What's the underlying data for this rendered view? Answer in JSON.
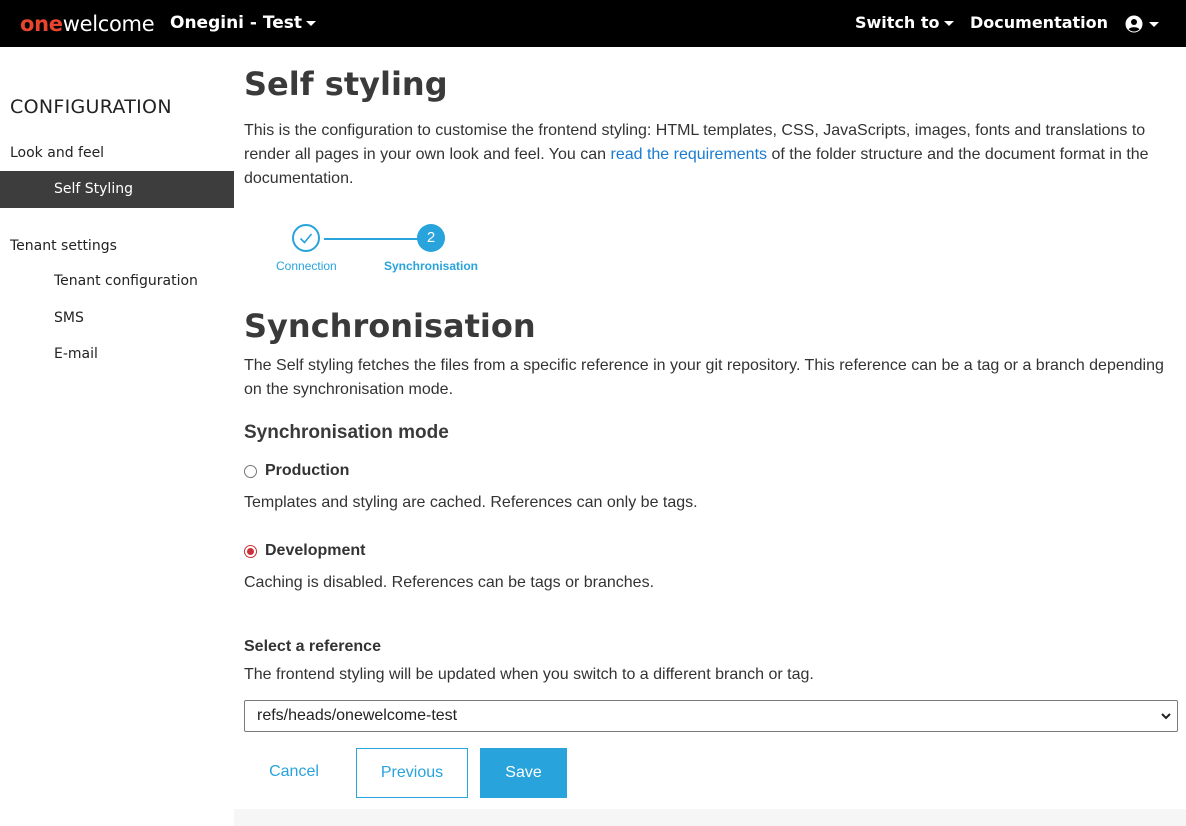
{
  "navbar": {
    "logo_one": "one",
    "logo_welcome": "welcome",
    "tenant": "Onegini - Test",
    "switch_to": "Switch to",
    "documentation": "Documentation",
    "user_icon": "user-circle-icon"
  },
  "sidebar": {
    "heading": "CONFIGURATION",
    "group_look": "Look and feel",
    "self_styling": "Self Styling",
    "group_tenant": "Tenant settings",
    "tenant_configuration": "Tenant configuration",
    "sms": "SMS",
    "email": "E-mail"
  },
  "main": {
    "title": "Self styling",
    "intro_before": "This is the configuration to customise the frontend styling: HTML templates, CSS, JavaScripts, images, fonts and translations to render all pages in your own look and feel. You can ",
    "intro_link": "read the requirements",
    "intro_after": " of the folder structure and the document format in the documentation.",
    "stepper": {
      "step1_label": "Connection",
      "step2_number": "2",
      "step2_label": "Synchronisation"
    },
    "section_title": "Synchronisation",
    "section_desc": "The Self styling fetches the files from a specific reference in your git repository. This reference can be a tag or a branch depending on the synchronisation mode.",
    "mode_title": "Synchronisation mode",
    "production_label": "Production",
    "production_desc": "Templates and styling are cached. References can only be tags.",
    "development_label": "Development",
    "development_desc": "Caching is disabled. References can be tags or branches.",
    "reference_label": "Select a reference",
    "reference_help": "The frontend styling will be updated when you switch to a different branch or tag.",
    "reference_value": "refs/heads/onewelcome-test",
    "cancel": "Cancel",
    "previous": "Previous",
    "save": "Save"
  },
  "colors": {
    "accent": "#28a3dc",
    "logo_red": "#e8442e",
    "radio_selected": "#c9303a",
    "sidebar_active": "#3d3d3d",
    "navbar": "#000000"
  }
}
